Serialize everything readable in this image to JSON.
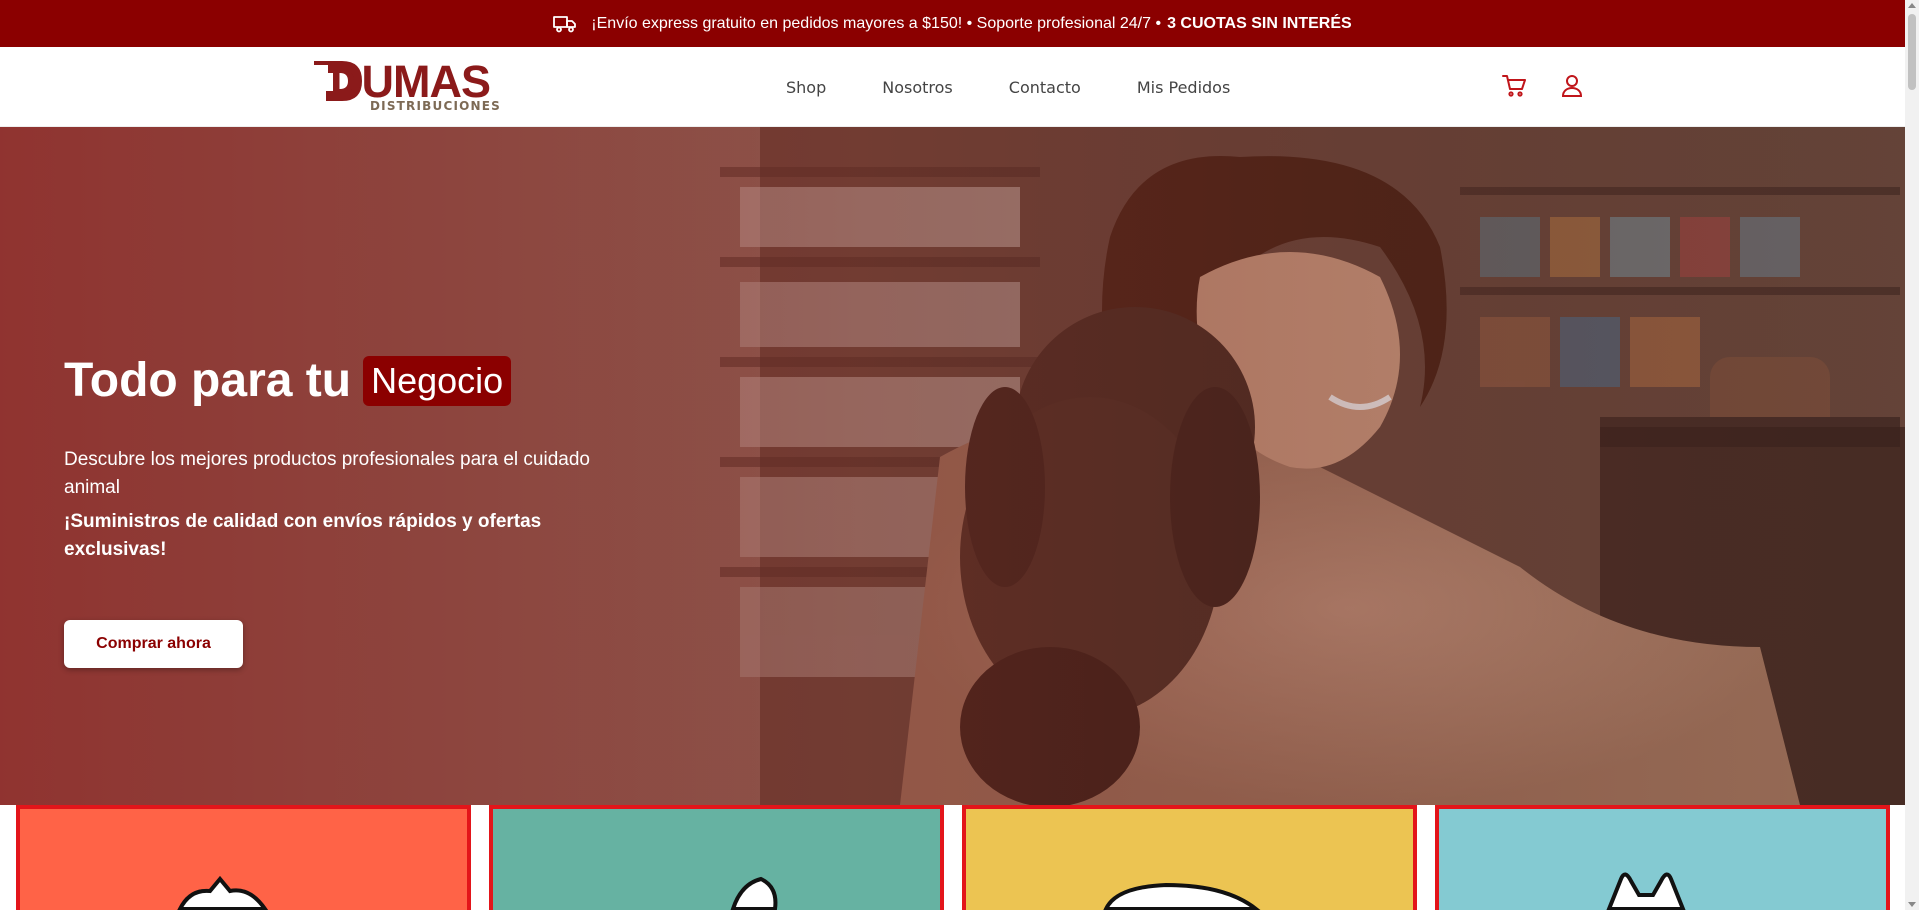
{
  "topbar": {
    "message": "¡Envío express gratuito en pedidos mayores a $150! • Soporte profesional 24/7 •",
    "highlight": "3 CUOTAS SIN INTERÉS",
    "icon": "truck-icon"
  },
  "brand": {
    "name": "DUMAS",
    "tagline": "DISTRIBUCIONES"
  },
  "nav": [
    {
      "label": "Shop"
    },
    {
      "label": "Nosotros"
    },
    {
      "label": "Contacto"
    },
    {
      "label": "Mis Pedidos"
    }
  ],
  "header_icons": [
    "cart-icon",
    "user-icon"
  ],
  "hero": {
    "title": "Todo para tu",
    "title_highlight": "Negocio",
    "description": "Descubre los mejores productos profesionales para el cuidado animal",
    "strong": "¡Suministros de calidad con envíos rápidos y ofertas exclusivas!",
    "cta": "Comprar ahora"
  },
  "categories": [
    {
      "color": "#ff6347"
    },
    {
      "color": "#66b2a2"
    },
    {
      "color": "#ecc452"
    },
    {
      "color": "#84cad2"
    }
  ],
  "colors": {
    "brand_red": "#8b0000",
    "accent_red": "#e3151a"
  }
}
